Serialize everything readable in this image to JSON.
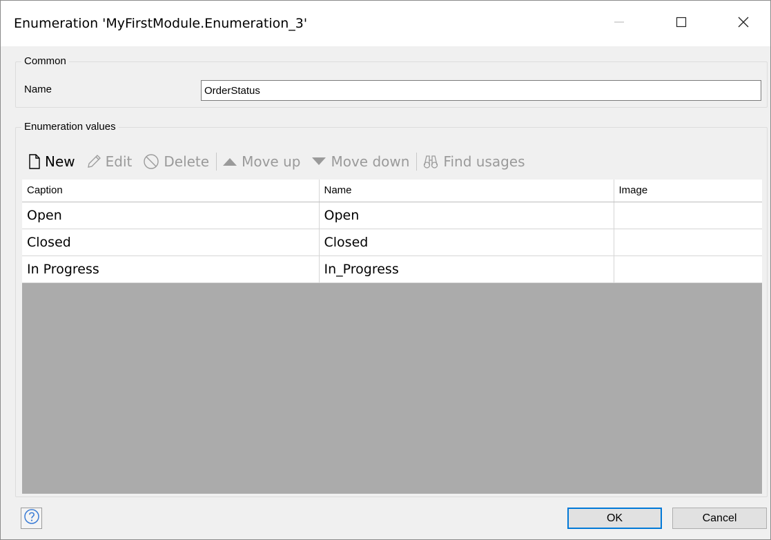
{
  "window": {
    "title": "Enumeration 'MyFirstModule.Enumeration_3'",
    "controls": {
      "minimize": "minimize-icon",
      "maximize": "maximize-icon",
      "close": "close-icon"
    }
  },
  "common": {
    "legend": "Common",
    "name_label": "Name",
    "name_value": "OrderStatus"
  },
  "values_group": {
    "legend": "Enumeration values",
    "toolbar": {
      "new": "New",
      "edit": "Edit",
      "delete": "Delete",
      "move_up": "Move up",
      "move_down": "Move down",
      "find_usages": "Find usages"
    },
    "columns": [
      "Caption",
      "Name",
      "Image"
    ],
    "rows": [
      {
        "caption": "Open",
        "name": "Open",
        "image": ""
      },
      {
        "caption": "Closed",
        "name": "Closed",
        "image": ""
      },
      {
        "caption": "In Progress",
        "name": "In_Progress",
        "image": ""
      }
    ]
  },
  "footer": {
    "help_icon": "help-icon",
    "ok": "OK",
    "cancel": "Cancel"
  },
  "colors": {
    "accent": "#0078d7",
    "empty_grid": "#ababab",
    "disabled_text": "#9a9a9a"
  }
}
